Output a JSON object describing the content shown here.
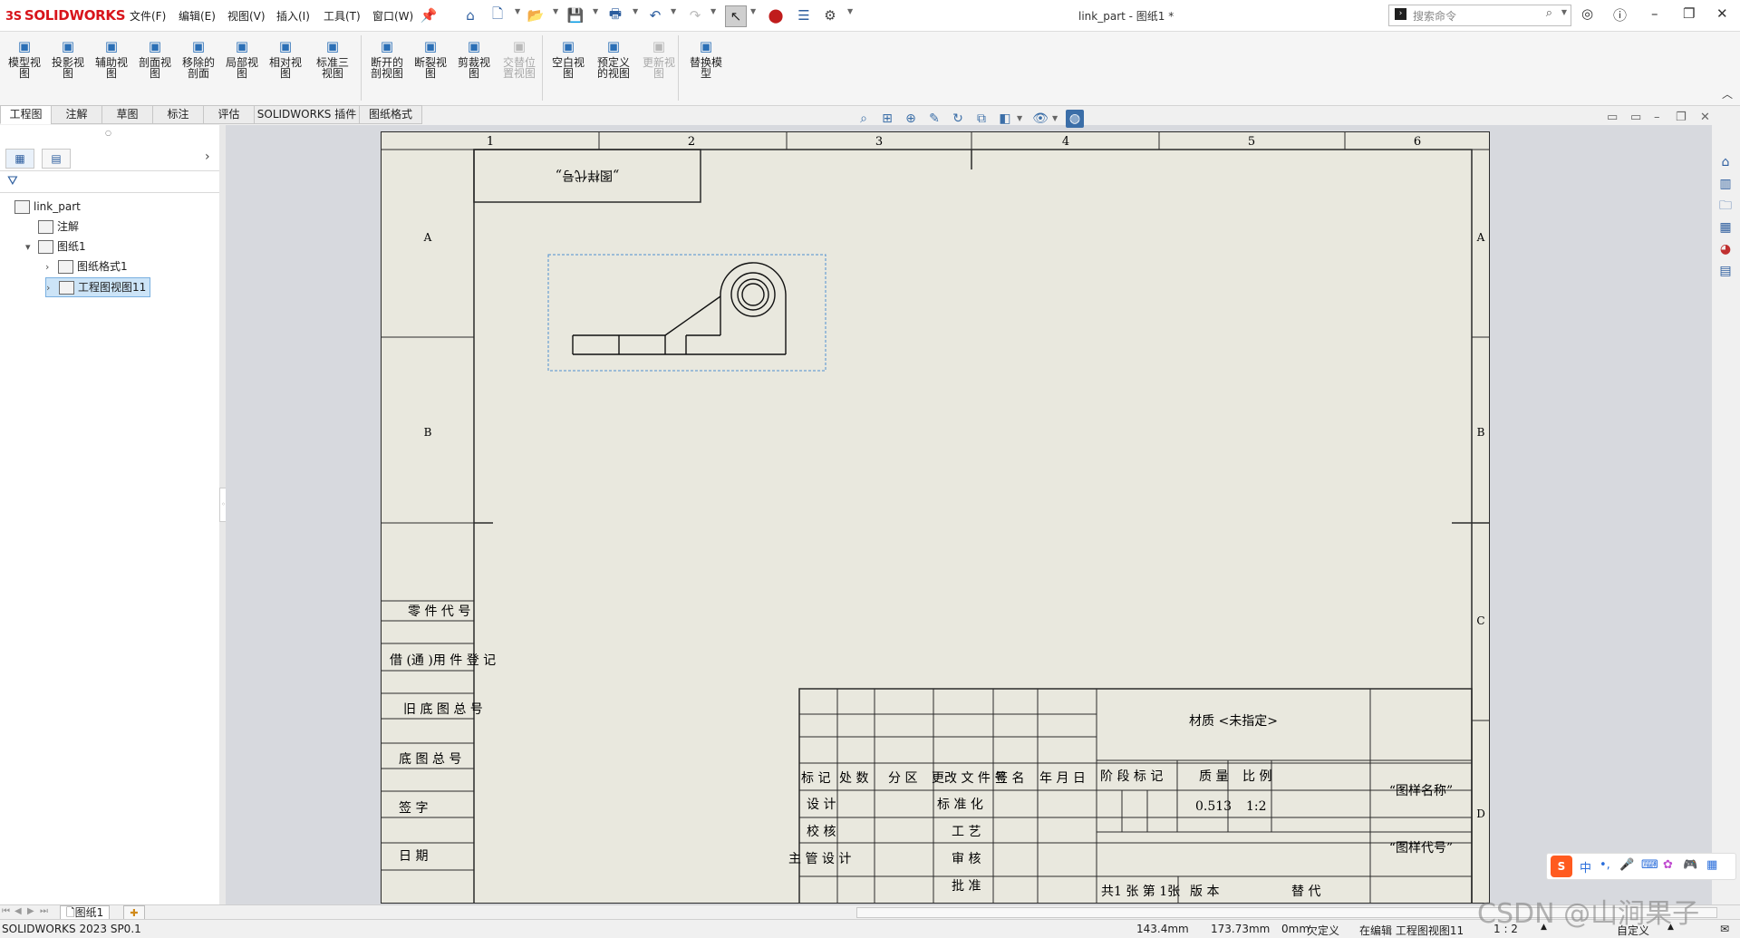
{
  "app": {
    "logo_text": "SOLIDWORKS",
    "logo_mark": "3S",
    "window_title": "link_part - 图纸1 *",
    "version": "SOLIDWORKS 2023 SP0.1"
  },
  "menu": [
    "文件(F)",
    "编辑(E)",
    "视图(V)",
    "插入(I)",
    "工具(T)",
    "窗口(W)"
  ],
  "search": {
    "placeholder": "搜索命令"
  },
  "ribbon": [
    {
      "label": "模型视\n图",
      "icon": "model-view-icon",
      "enabled": true
    },
    {
      "label": "投影视\n图",
      "icon": "projected-view-icon",
      "enabled": true
    },
    {
      "label": "辅助视\n图",
      "icon": "auxiliary-view-icon",
      "enabled": true
    },
    {
      "label": "剖面视\n图",
      "icon": "section-view-icon",
      "enabled": true
    },
    {
      "label": "移除的\n剖面",
      "icon": "removed-section-icon",
      "enabled": true
    },
    {
      "label": "局部视\n图",
      "icon": "detail-view-icon",
      "enabled": true
    },
    {
      "label": "相对视\n图",
      "icon": "relative-view-icon",
      "enabled": true
    },
    {
      "label": "标准三\n视图",
      "icon": "standard-3-view-icon",
      "enabled": true
    },
    {
      "label": "断开的\n剖视图",
      "icon": "broken-out-section-icon",
      "enabled": true
    },
    {
      "label": "断裂视\n图",
      "icon": "break-view-icon",
      "enabled": true
    },
    {
      "label": "剪裁视\n图",
      "icon": "crop-view-icon",
      "enabled": true
    },
    {
      "label": "交替位\n置视图",
      "icon": "alternate-position-icon",
      "enabled": false
    },
    {
      "label": "空白视\n图",
      "icon": "empty-view-icon",
      "enabled": true
    },
    {
      "label": "预定义\n的视图",
      "icon": "predefined-view-icon",
      "enabled": true
    },
    {
      "label": "更新视\n图",
      "icon": "update-view-icon",
      "enabled": false
    },
    {
      "label": "替换模\n型",
      "icon": "replace-model-icon",
      "enabled": true
    }
  ],
  "tabs": [
    {
      "label": "工程图",
      "active": true
    },
    {
      "label": "注解",
      "active": false
    },
    {
      "label": "草图",
      "active": false
    },
    {
      "label": "标注",
      "active": false
    },
    {
      "label": "评估",
      "active": false
    },
    {
      "label": "SOLIDWORKS 插件",
      "active": false
    },
    {
      "label": "图纸格式",
      "active": false
    }
  ],
  "tree": [
    {
      "label": "link_part",
      "icon": "drawing-icon",
      "indent": 0,
      "expander": ""
    },
    {
      "label": "注解",
      "icon": "annotation-icon",
      "indent": 1,
      "expander": ""
    },
    {
      "label": "图纸1",
      "icon": "sheet-icon",
      "indent": 1,
      "expander": "▾"
    },
    {
      "label": "图纸格式1",
      "icon": "sheet-format-icon",
      "indent": 2,
      "expander": "›"
    },
    {
      "label": "工程图视图11",
      "icon": "drawing-view-icon",
      "indent": 2,
      "expander": "›",
      "selected": true
    }
  ],
  "drawing": {
    "col_numbers": [
      "1",
      "2",
      "3",
      "4",
      "5",
      "6"
    ],
    "row_letters_left": [
      "A",
      "B"
    ],
    "row_letters_right": [
      "A",
      "B",
      "C",
      "D"
    ],
    "code_box_text": "„图样代号„",
    "left_strip": [
      "零 件 代 号",
      "借 (通 )用 件 登 记",
      "旧 底 图 总 号",
      "底  图  总  号",
      "签    字",
      "日    期"
    ],
    "title_block": {
      "header_cells": [
        "标 记",
        "处 数",
        "分 区",
        "更改 文 件 号",
        "签 名",
        "年  月  日"
      ],
      "rows_left": [
        "设 计",
        "校 核",
        "主 管 设 计"
      ],
      "rows_mid": [
        "标 准 化",
        "工 艺",
        "审 核",
        "批 准"
      ],
      "material": "材质 <未指定>",
      "stage_label": "阶 段 标 记",
      "mass_label": "质 量",
      "scale_label": "比 例",
      "mass_value": "0.513",
      "scale_value": "1:2",
      "drawing_name": "“图样名称”",
      "drawing_code": "“图样代号”",
      "sheet_info": "共1 张  第  1张",
      "version_label": "版 本",
      "replace_label": "替 代"
    }
  },
  "sheet_tab": "图纸1",
  "status": {
    "x": "143.4mm",
    "y": "173.73mm",
    "z": "0mm",
    "define": "欠定义",
    "editing": "在编辑 工程图视图11",
    "scale": "1 : 2",
    "custom": "自定义"
  },
  "watermark": "CSDN @山涧果子",
  "colors": {
    "accent": "#2c5d9e",
    "brand": "#d8141b",
    "sheet": "#e9e8de",
    "graphics_bg": "#d7d9de",
    "selection": "#cce4f7"
  }
}
